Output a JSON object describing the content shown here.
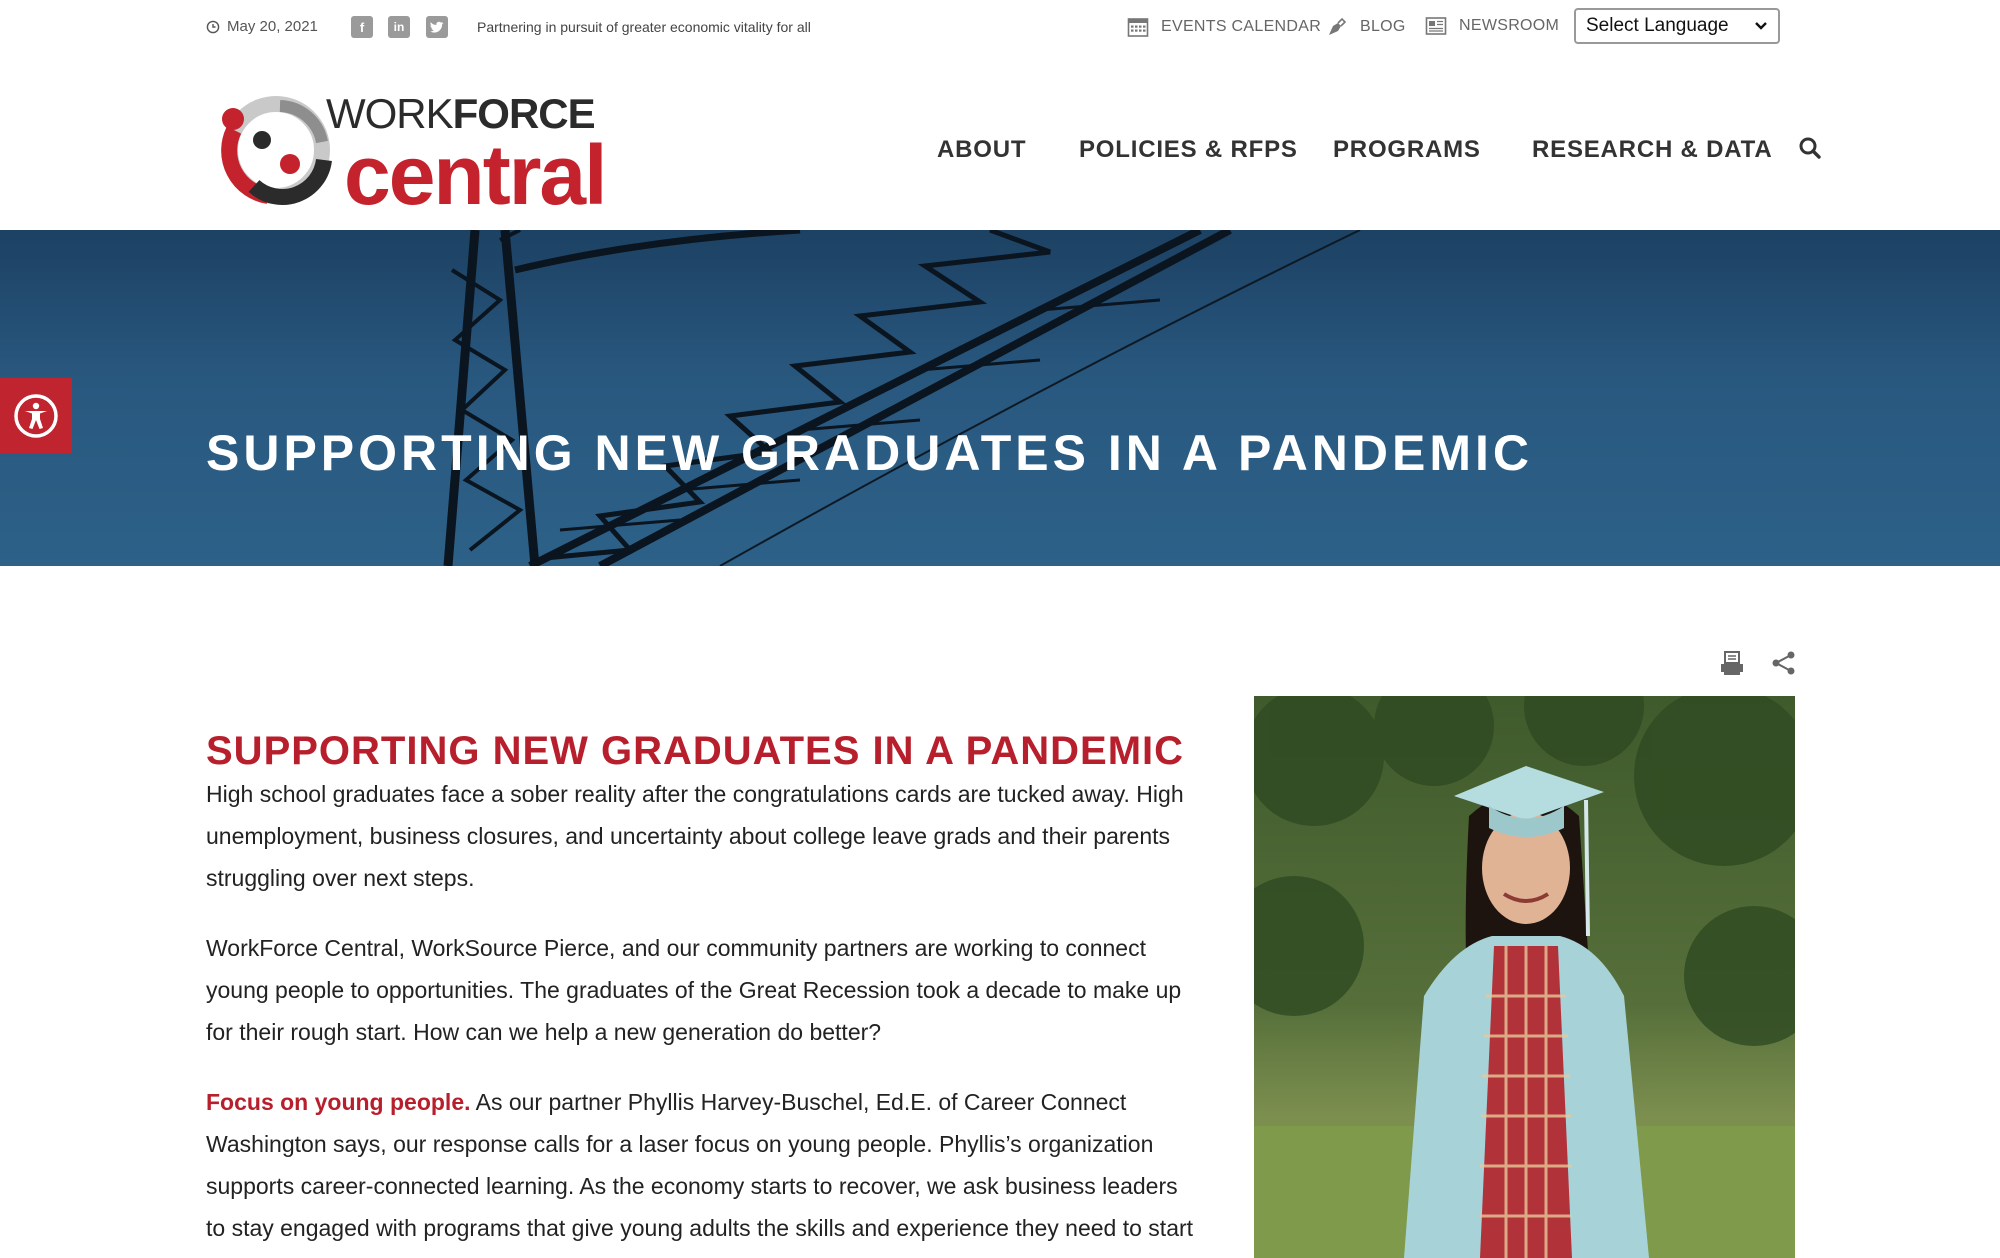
{
  "topbar": {
    "date": "May 20, 2021",
    "tagline": "Partnering in pursuit of greater economic vitality for all",
    "events_label": "EVENTS CALENDAR",
    "blog_label": "BLOG",
    "newsroom_label": "NEWSROOM",
    "language_select": "Select Language",
    "social": {
      "facebook": "f",
      "linkedin": "in"
    }
  },
  "logo": {
    "line1_light": "WORK",
    "line1_bold": "FORCE",
    "line2": "central"
  },
  "nav": {
    "items": [
      {
        "label": "ABOUT"
      },
      {
        "label": "POLICIES & RFPS"
      },
      {
        "label": "PROGRAMS"
      },
      {
        "label": "RESEARCH & DATA"
      }
    ]
  },
  "hero": {
    "title": "SUPPORTING NEW GRADUATES IN A PANDEMIC"
  },
  "article": {
    "title": "SUPPORTING NEW GRADUATES IN A PANDEMIC",
    "p1": "High school graduates face a sober reality after the congratulations cards are tucked away. High unemployment, business closures, and uncertainty about college leave grads and their parents struggling over next steps.",
    "p2": "WorkForce Central, WorkSource Pierce, and our community partners are working to connect young people to opportunities. The graduates of the Great Recession took a decade to make up for their rough start. How can we help a new generation do better?",
    "p3_lead": "Focus on young people.",
    "p3_rest": " As our partner Phyllis Harvey-Buschel, Ed.E. of Career Connect Washington says, our response calls for a laser focus on young people. Phyllis’s organization supports career-connected learning. As the economy starts to recover, we ask business leaders to stay engaged with programs that give young adults the skills and experience they need to start"
  },
  "colors": {
    "brand_red": "#b81f2c",
    "hero_blue": "#29587f",
    "nav_text": "#333333"
  }
}
